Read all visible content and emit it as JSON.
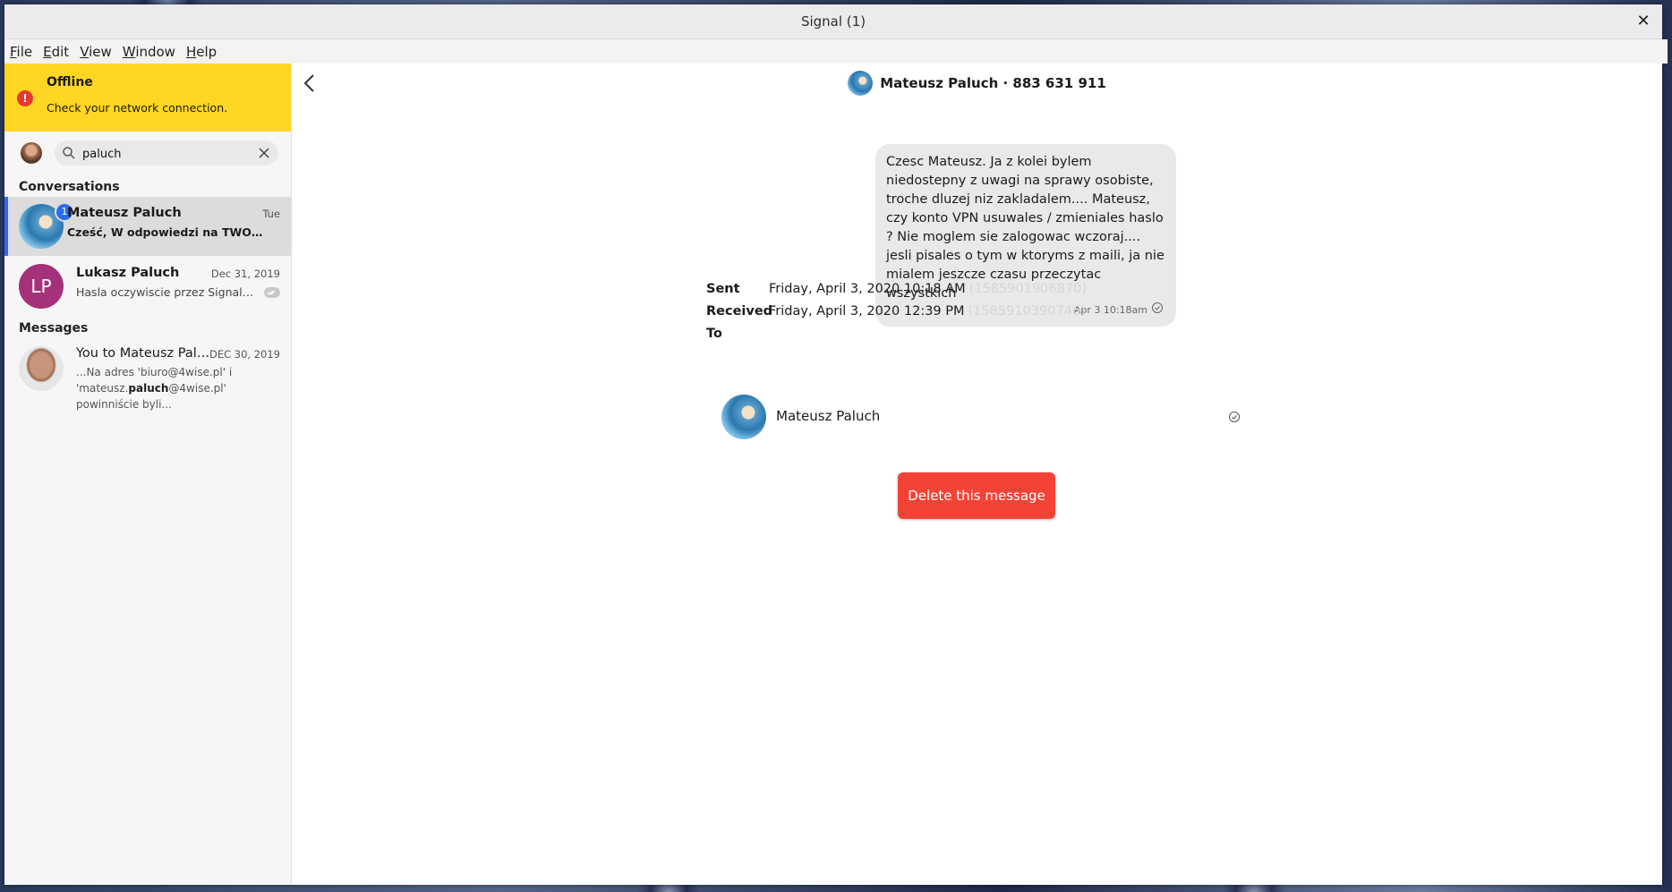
{
  "window": {
    "title": "Signal (1)",
    "close_glyph": "✕"
  },
  "menu": [
    "File",
    "Edit",
    "View",
    "Window",
    "Help"
  ],
  "offline": {
    "title": "Offline",
    "subtitle": "Check your network connection.",
    "icon": "!"
  },
  "search": {
    "value": "paluch"
  },
  "sections": {
    "conversations": "Conversations",
    "messages": "Messages"
  },
  "conversations": [
    {
      "name": "Mateusz Paluch",
      "date": "Tue",
      "snippet": "Cześć, W odpowiedzi na TWOJA ...",
      "unread": "1"
    },
    {
      "initials": "LP",
      "name": "Lukasz Paluch",
      "date": "Dec 31, 2019",
      "snippet": "Hasla oczywiscie przez Signal ..."
    }
  ],
  "message_result": {
    "name": "You to Mateusz Paluch",
    "date": "DEC 30, 2019",
    "line1": "...Na adres 'biuro@4wise.pl' i",
    "line2_pre": "'mateusz.",
    "line2_bold": "paluch",
    "line2_post": "@4wise.pl'",
    "line3": "powinniście byli..."
  },
  "header": {
    "title": "Mateusz Paluch · 883 631 911"
  },
  "message": {
    "text": "Czesc Mateusz. Ja z kolei bylem niedostepny z uwagi na sprawy osobiste, troche dluzej niz zakladalem.... Mateusz, czy konto VPN usuwales / zmieniales haslo ? Nie moglem sie zalogowac wczoraj.... jesli pisales o tym w ktoryms z maili, ja nie mialem jeszcze czasu przeczytac wszystkich",
    "time": "Apr 3 10:18am"
  },
  "details": {
    "sent_label": "Sent",
    "sent_value": "Friday, April 3, 2020 10:18 AM",
    "sent_ts": "(1585901906870)",
    "received_label": "Received",
    "received_value": "Friday, April 3, 2020 12:39 PM",
    "received_ts": "(1585910390746)",
    "to_label": "To"
  },
  "recipient": {
    "name": "Mateusz Paluch"
  },
  "actions": {
    "delete_label": "Delete this message"
  },
  "colors": {
    "offline_banner": "#ffd624",
    "accent": "#2c6bed",
    "danger": "#f44336",
    "lp_avatar": "#a5317b"
  }
}
